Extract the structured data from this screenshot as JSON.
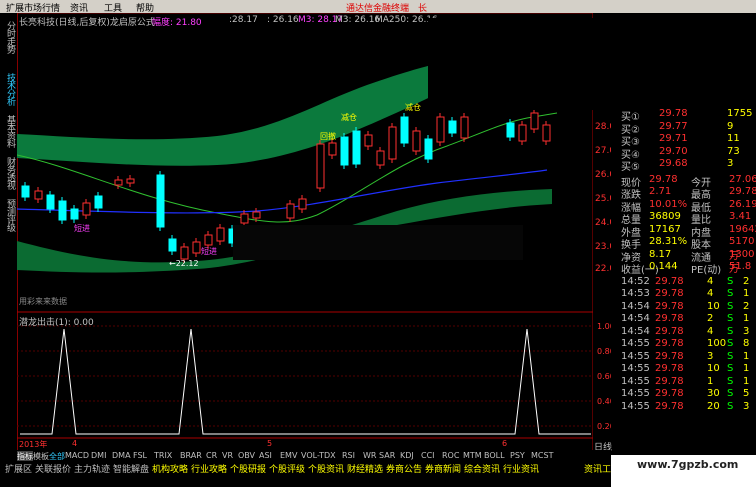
{
  "menu": {
    "items": [
      "扩展市场行情",
      "资讯",
      "工具",
      "帮助"
    ],
    "right_text": "通达信金融终端",
    "right_extra": "长"
  },
  "left_nav": [
    "分时走势",
    "技术分析",
    "基本资料",
    "财务透视",
    "预测评级"
  ],
  "header": {
    "title": "长亮科技(日线,后复权)龙启原公式",
    "amp_label": "幅度: 21.80",
    "ma_vals": [
      ":28.17",
      ": 26.16",
      "M3: 28.17",
      "M3: 26.16",
      "MA250: 26.16"
    ]
  },
  "price_axis": [
    "28.00",
    "27.00",
    "26.00",
    "25.00",
    "24.00",
    "23.00",
    "22.00"
  ],
  "chart_labels": {
    "low": "←22.12",
    "tag1": "短进",
    "tag2": "短进",
    "tag3": "减仓",
    "tag4": "减仓",
    "tag5": "回撤",
    "watermark": "用彩来来数据"
  },
  "indicator": {
    "title": "潜龙出击(1): 0.00",
    "axis": [
      "1.00",
      "0.80",
      "0.60",
      "0.40",
      "0.20"
    ]
  },
  "date_axis": {
    "left": "2013年",
    "m1": "4",
    "m2": "5",
    "m3": "6"
  },
  "quote": {
    "asks": [
      {
        "label": "买①",
        "price": "29.78",
        "vol": "1755"
      },
      {
        "label": "买②",
        "price": "29.77",
        "vol": "9"
      },
      {
        "label": "买③",
        "price": "29.71",
        "vol": "11"
      },
      {
        "label": "买④",
        "price": "29.70",
        "vol": "73"
      },
      {
        "label": "买⑤",
        "price": "29.68",
        "vol": "3"
      }
    ],
    "stats": [
      {
        "a": "现价",
        "b": "29.78",
        "c": "今开",
        "d": "27.06"
      },
      {
        "a": "涨跌",
        "b": "2.71",
        "c": "最高",
        "d": "29.78"
      },
      {
        "a": "涨幅",
        "b": "10.01%",
        "c": "最低",
        "d": "26.19"
      },
      {
        "a": "总量",
        "b": "36809",
        "c": "量比",
        "d": "3.41"
      },
      {
        "a": "外盘",
        "b": "17167",
        "c": "内盘",
        "d": "19642"
      },
      {
        "a": "换手",
        "b": "28.31%",
        "c": "股本",
        "d": "5170万"
      },
      {
        "a": "净资",
        "b": "8.17",
        "c": "流通",
        "d": "1300万"
      },
      {
        "a": "收益(一)",
        "b": "0.144",
        "c": "PE(动)",
        "d": "51.8"
      }
    ],
    "ticks": [
      {
        "t": "14:52",
        "p": "29.78",
        "v": "4",
        "s": "S",
        "n": "2"
      },
      {
        "t": "14:53",
        "p": "29.78",
        "v": "4",
        "s": "S",
        "n": "1"
      },
      {
        "t": "14:54",
        "p": "29.78",
        "v": "10",
        "s": "S",
        "n": "2"
      },
      {
        "t": "14:54",
        "p": "29.78",
        "v": "2",
        "s": "S",
        "n": "1"
      },
      {
        "t": "14:54",
        "p": "29.78",
        "v": "4",
        "s": "S",
        "n": "3"
      },
      {
        "t": "14:55",
        "p": "29.78",
        "v": "100",
        "s": "S",
        "n": "8"
      },
      {
        "t": "14:55",
        "p": "29.78",
        "v": "3",
        "s": "S",
        "n": "1"
      },
      {
        "t": "14:55",
        "p": "29.78",
        "v": "10",
        "s": "S",
        "n": "1"
      },
      {
        "t": "14:55",
        "p": "29.78",
        "v": "1",
        "s": "S",
        "n": "1"
      },
      {
        "t": "14:55",
        "p": "29.78",
        "v": "30",
        "s": "S",
        "n": "5"
      },
      {
        "t": "14:55",
        "p": "29.78",
        "v": "20",
        "s": "S",
        "n": "3"
      }
    ]
  },
  "tabs": [
    "指标",
    "模板",
    "全部",
    "MACD",
    "DMI",
    "DMA",
    "FSL",
    "TRIX",
    "BRAR",
    "CR",
    "VR",
    "OBV",
    "ASI",
    "EMV",
    "VOL-TDX",
    "RSI",
    "WR",
    "SAR",
    "KDJ",
    "CCI",
    "ROC",
    "MTM",
    "BOLL",
    "PSY",
    "MCST"
  ],
  "side_label": "日线",
  "bottom_bar": [
    "扩展区",
    "关联报价",
    "主力轨迹",
    "智能解盘",
    "机构攻略",
    "行业攻略",
    "个股研报",
    "个股评级",
    "个股资讯",
    "财经精选",
    "券商公告",
    "券商新闻",
    "综合资讯",
    "行业资讯"
  ],
  "bottom_right": "资讯工",
  "watermark_url": "www.7gpzb.com",
  "colors": {
    "up": "#ff3030",
    "down": "#00ffff",
    "green": "#00ff00",
    "yellow": "#ffff00",
    "magenta": "#ff40ff",
    "band": "#0a7a3a"
  }
}
